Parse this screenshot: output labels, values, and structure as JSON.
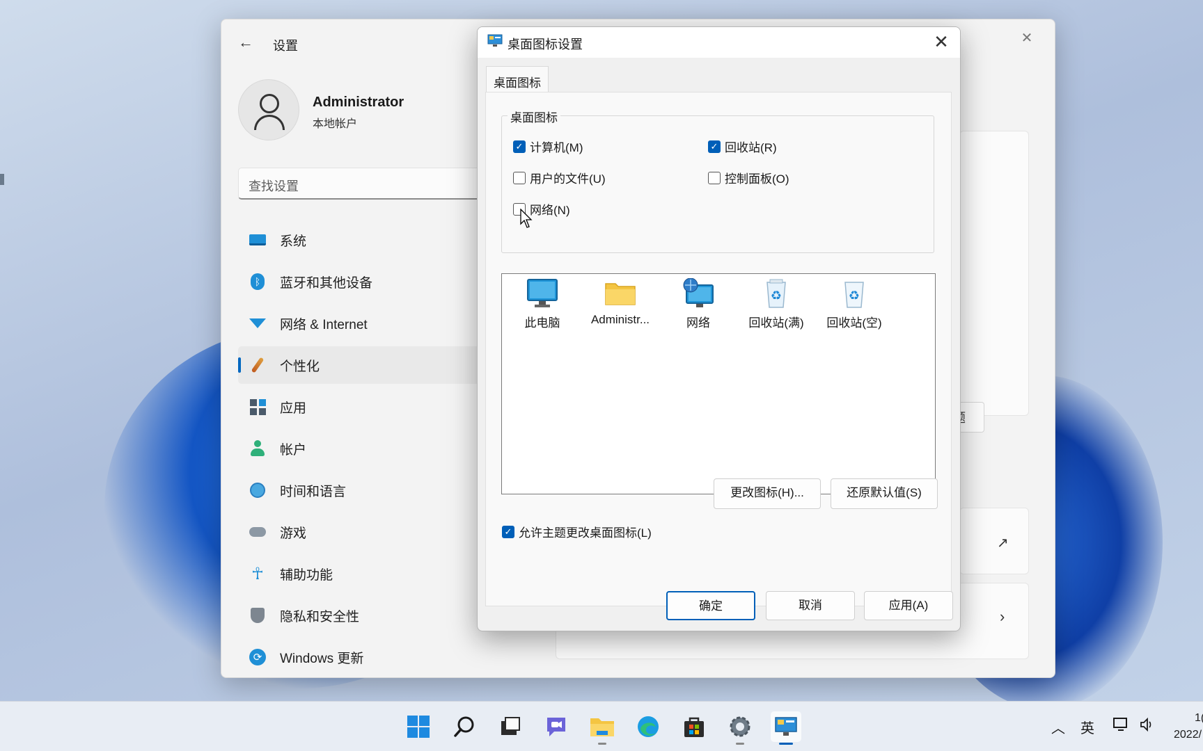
{
  "settings": {
    "title": "设置",
    "user": {
      "name": "Administrator",
      "type": "本地帐户"
    },
    "search_placeholder": "查找设置",
    "nav": [
      {
        "label": "系统",
        "icon": "monitor-icon"
      },
      {
        "label": "蓝牙和其他设备",
        "icon": "bluetooth-icon"
      },
      {
        "label": "网络 & Internet",
        "icon": "wifi-icon"
      },
      {
        "label": "个性化",
        "icon": "brush-icon",
        "active": true
      },
      {
        "label": "应用",
        "icon": "apps-icon"
      },
      {
        "label": "帐户",
        "icon": "person-icon"
      },
      {
        "label": "时间和语言",
        "icon": "globe-clock-icon"
      },
      {
        "label": "游戏",
        "icon": "gamepad-icon"
      },
      {
        "label": "辅助功能",
        "icon": "accessibility-icon"
      },
      {
        "label": "隐私和安全性",
        "icon": "shield-icon"
      },
      {
        "label": "Windows 更新",
        "icon": "sync-icon"
      }
    ],
    "bg_button_fragment": "题"
  },
  "dialog": {
    "title": "桌面图标设置",
    "tab": "桌面图标",
    "group_label": "桌面图标",
    "checkboxes": {
      "computer": {
        "label": "计算机(M)",
        "checked": true
      },
      "recycle": {
        "label": "回收站(R)",
        "checked": true
      },
      "user_files": {
        "label": "用户的文件(U)",
        "checked": false
      },
      "control_panel": {
        "label": "控制面板(O)",
        "checked": false
      },
      "network": {
        "label": "网络(N)",
        "checked": false
      }
    },
    "icons": [
      {
        "label": "此电脑",
        "icon": "computer-icon"
      },
      {
        "label": "Administr...",
        "icon": "folder-icon"
      },
      {
        "label": "网络",
        "icon": "network-icon"
      },
      {
        "label": "回收站(满)",
        "icon": "recycle-bin-full-icon"
      },
      {
        "label": "回收站(空)",
        "icon": "recycle-bin-empty-icon"
      }
    ],
    "change_icon_button": "更改图标(H)...",
    "restore_default_button": "还原默认值(S)",
    "allow_themes": {
      "label": "允许主题更改桌面图标(L)",
      "checked": true
    },
    "ok_button": "确定",
    "cancel_button": "取消",
    "apply_button": "应用(A)"
  },
  "taskbar": {
    "apps": [
      "start-icon",
      "search-icon",
      "task-view-icon",
      "chat-icon",
      "file-explorer-icon",
      "edge-icon",
      "store-icon",
      "settings-icon",
      "desktop-icons-app-icon"
    ],
    "ime": "英",
    "clock_time": "1(",
    "clock_date": "2022/"
  },
  "colors": {
    "accent": "#005fb8",
    "active_indicator": "#0067c0"
  }
}
